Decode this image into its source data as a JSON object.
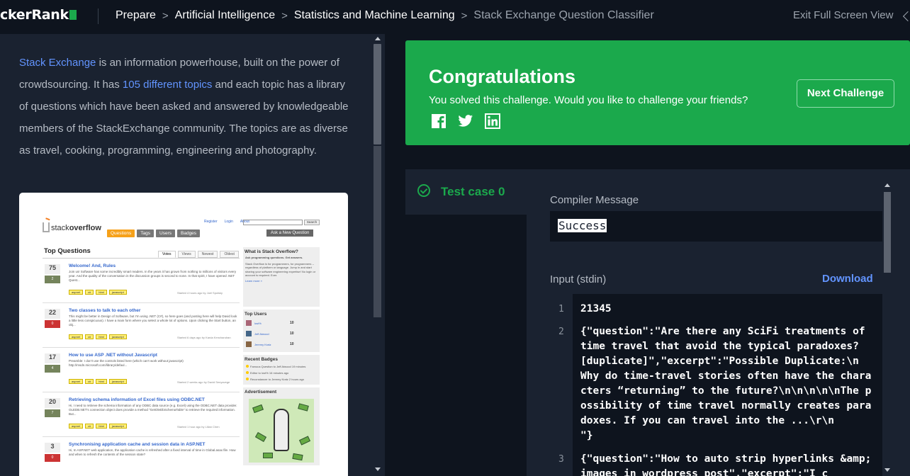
{
  "header": {
    "logo": "ckerRank",
    "breadcrumbs": [
      "Prepare",
      "Artificial Intelligence",
      "Statistics and Machine Learning",
      "Stack Exchange Question Classifier"
    ],
    "exit_label": "Exit Full Screen View"
  },
  "problem": {
    "p1_link1": "Stack Exchange",
    "p1_t1": " is an information powerhouse, built on the power of crowdsourcing. It has ",
    "p1_link2": "105 different topics",
    "p1_t2": " and each topic has a library of questions which have been asked and answered by knowledgeable members of the StackExchange community. The topics are as diverse as travel, cooking, programming, engineering and photography."
  },
  "screenshot": {
    "logo_a": "stack",
    "logo_b": "overflow",
    "nav": [
      "Questions",
      "Tags",
      "Users",
      "Badges"
    ],
    "links": [
      "Register",
      "Login",
      "About"
    ],
    "search_btn": "Search",
    "ask": "Ask a New Question",
    "title": "Top Questions",
    "tabs": [
      "Votes",
      "Views",
      "Newest",
      "Oldest"
    ],
    "questions": [
      {
        "votes": "75",
        "answers": "2 answers",
        "title": "Welcome! And, Rules",
        "text": "Join us! Software has some incredibly smart readers. In the years it has grown from nothing to millions of visitors every year. And the quality of the conversation in the discussion groups is second to none. In that spirit, I have opened .NET Quest...",
        "tags": [
          "aspnet",
          "c#",
          "html",
          "javascript"
        ],
        "meta": "Started 4 hours ago by  Joel Spolsky"
      },
      {
        "votes": "22",
        "answers": "0 answers",
        "title": "Two classes to talk to each other",
        "text": "This might be better in Design of Software, but I'm using .NET (C#), so here goes (and posting here will help David look a little less conspicuous). I have a main form where you select a whole lot of options. Upon clicking the Start button, an obj...",
        "tags": [
          "aspnet",
          "c#",
          "html",
          "javascript"
        ],
        "meta": "Started 6 days ago by  Karda Kenchandran"
      },
      {
        "votes": "17",
        "answers": "4 answers",
        "title": "How to use ASP .NET without Javascript",
        "text": "Preamble: I don't use the controls listed here (which can't work without javascript) http://msdn.microsoft.com/library/defaul...",
        "tags": [
          "aspnet",
          "c#",
          "html",
          "javascript"
        ],
        "meta": "Started 2 weeks ago by  David Senyavege"
      },
      {
        "votes": "20",
        "answers": "7 answers",
        "title": "Retrieving schema information of Excel files using ODBC.NET",
        "text": "Hi, I need to retrieve the schema information of any ODBC data source (e.g. Excel) using the ODBC.NET data provider. OLEDB.NET's connection object does provide a method \"GetOleDbSchemaTable\" to retrieve the required information. But...",
        "tags": [
          "aspnet",
          "c#",
          "html",
          "javascript"
        ],
        "meta": "Started 1 hour ago by  Lilian Chen"
      },
      {
        "votes": "3",
        "answers": "0 answers",
        "title": "Synchronising application cache and session data in ASP.NET",
        "text": "Hi, In ASP.NET web application, the application cache is refreshed after a fixed interval of time in Global.asax file. How and when to refresh the contents of the session state?",
        "tags": [],
        "meta": ""
      }
    ],
    "about_title": "What is Stack Overflow?",
    "about_bold": "Ask programming questions. Get answers.",
    "about_text": "Stack Overflow is for programmers, for programmers -- regardless of platform or language. Jump in and start sharing your software engineering expertise! No login or account is required. Ever.",
    "about_more": "Learn more »",
    "top_users_title": "Top Users",
    "users": [
      {
        "name": "lost%",
        "score": "10"
      },
      {
        "name": "Jeff Atwood",
        "score": "10"
      },
      {
        "name": "Jeremy Kratz",
        "score": "10"
      }
    ],
    "badges_title": "Recent Badges",
    "badges": [
      "Famous Question to Jeff Atwood 19 minutes",
      "Editor to lost% 16 minutes ago",
      "Reconstancer to Jeremy Kratz 2 hours ago"
    ],
    "ad_title": "Advertisement"
  },
  "congrats": {
    "title": "Congratulations",
    "subtitle": "You solved this challenge. Would you like to challenge your friends?",
    "next_label": "Next Challenge",
    "accent": "#1ba94c"
  },
  "testcase": {
    "label": "Test case 0"
  },
  "output": {
    "compiler_label": "Compiler Message",
    "compiler_value": "Success",
    "input_label": "Input (stdin)",
    "download_label": "Download",
    "lines": [
      {
        "n": "1",
        "text": "21345"
      },
      {
        "n": "2",
        "text": "{\"question\":\"Are there any SciFi treatments of time travel that avoid the typical paradoxes? [duplicate]\",\"excerpt\":\"Possible Duplicate:\\n  Why do time-travel stories often have the characters “returning” to the future?\\n\\n\\n\\n\\nThe possibility of time travel normally creates paradoxes. If you can travel into the ...\\r\\n        \"}"
      },
      {
        "n": "3",
        "text": "{\"question\":\"How to auto strip hyperlinks &amp; images in wordpress post\",\"excerpt\":\"I c"
      }
    ]
  }
}
